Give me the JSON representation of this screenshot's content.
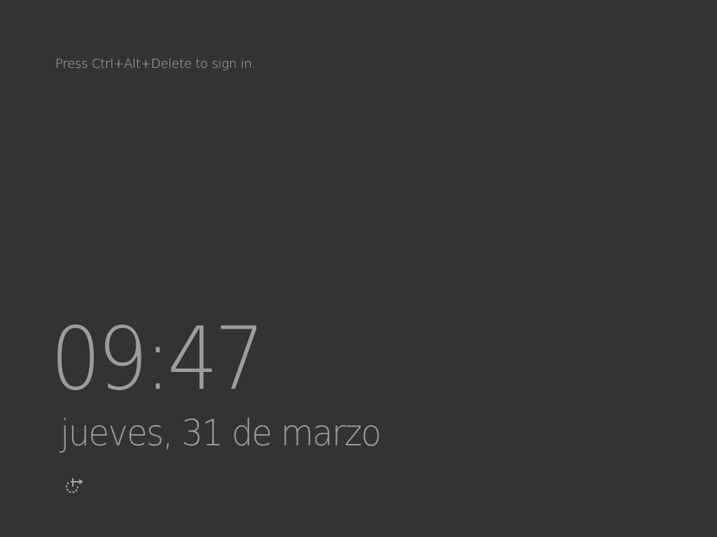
{
  "lock_screen": {
    "hint": "Press Ctrl+Alt+Delete to sign in.",
    "time": "09:47",
    "date": "jueves, 31 de marzo",
    "ease_of_access_icon": "ease-of-access-icon"
  },
  "colors": {
    "background": "#333333",
    "clock_text": "#9c9c9c",
    "hint_text": "#b8b8b8"
  }
}
